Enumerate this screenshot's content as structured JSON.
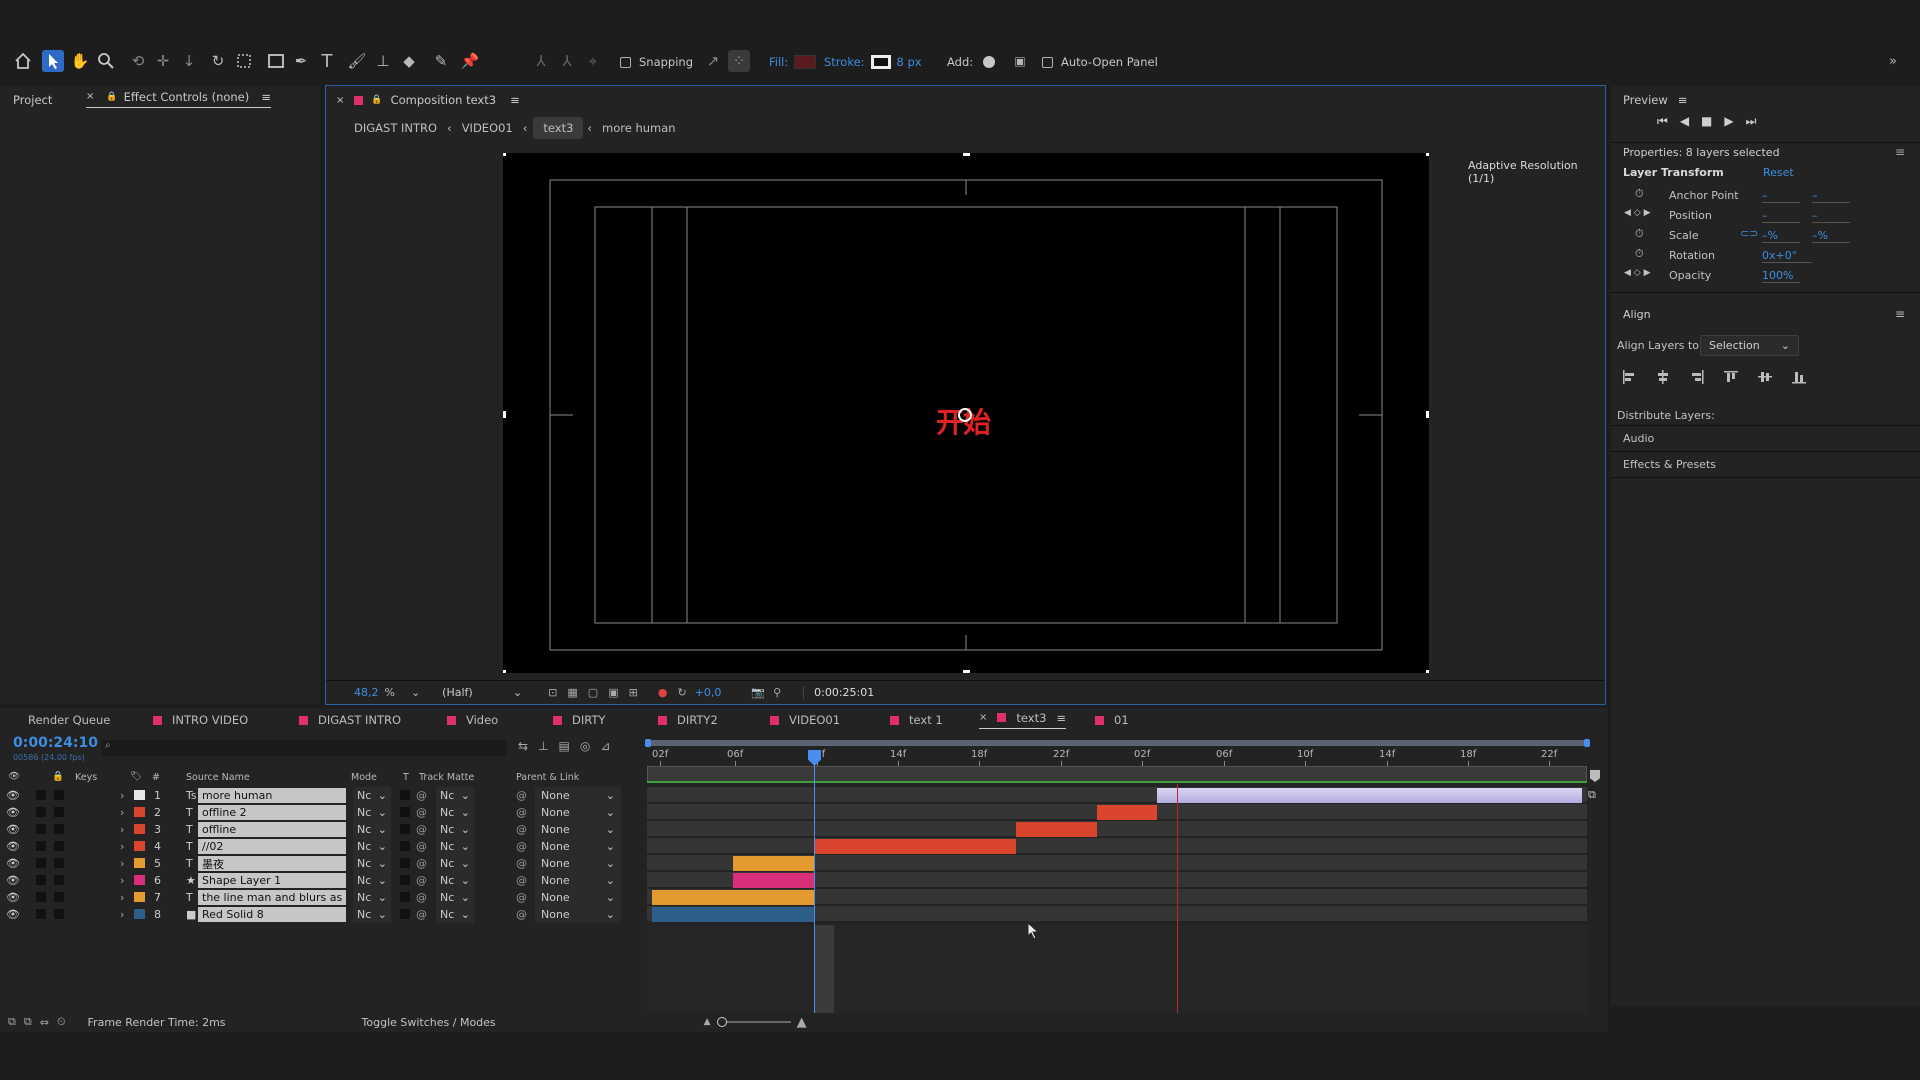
{
  "toolbar": {
    "snapping_label": "Snapping",
    "fill_label": "Fill:",
    "stroke_label": "Stroke:",
    "stroke_width": "8 px",
    "add_label": "Add:",
    "auto_open_label": "Auto-Open Panel",
    "fill_color": "#c0262c"
  },
  "left_panel": {
    "project_tab": "Project",
    "effect_controls_tab": "Effect Controls (none)"
  },
  "composition": {
    "tab_label": "Composition text3",
    "breadcrumbs": [
      "DIGAST INTRO",
      "VIDEO01",
      "text3",
      "more human"
    ],
    "adaptive_label": "Adaptive Resolution (1/1)",
    "canvas_text": "开始",
    "zoom": "48,2",
    "zoom_unit": "%",
    "resolution": "(Half)",
    "exposure": "+0,0",
    "timecode": "0:00:25:01"
  },
  "right_panel": {
    "preview_title": "Preview",
    "properties_title": "Properties: 8 layers selected",
    "layer_transform": "Layer Transform",
    "reset": "Reset",
    "props": [
      {
        "name": "Anchor Point",
        "v1": "–",
        "v2": "–"
      },
      {
        "name": "Position",
        "v1": "–",
        "v2": "–"
      },
      {
        "name": "Scale",
        "v1": "–%",
        "v2": "–%"
      },
      {
        "name": "Rotation",
        "v1": "0x+0°",
        "v2": ""
      },
      {
        "name": "Opacity",
        "v1": "100%",
        "v2": ""
      }
    ],
    "align_title": "Align",
    "align_layers_to": "Align Layers to:",
    "align_selection": "Selection",
    "distribute_label": "Distribute Layers:",
    "audio": "Audio",
    "effects_presets": "Effects & Presets"
  },
  "timeline": {
    "tabs": [
      {
        "label": "Render Queue",
        "color": ""
      },
      {
        "label": "INTRO VIDEO",
        "color": "#e0306a"
      },
      {
        "label": "DIGAST INTRO",
        "color": "#e0306a"
      },
      {
        "label": "Video",
        "color": "#e0306a"
      },
      {
        "label": "DIRTY",
        "color": "#e0306a"
      },
      {
        "label": "DIRTY2",
        "color": "#e0306a"
      },
      {
        "label": "VIDEO01",
        "color": "#e0306a"
      },
      {
        "label": "text 1",
        "color": "#e0306a"
      },
      {
        "label": "text3",
        "color": "#e0306a"
      },
      {
        "label": "01",
        "color": "#e0306a"
      }
    ],
    "current_time": "0:00:24:10",
    "frame_info": "00586 (24.00 fps)",
    "columns": {
      "keys": "Keys",
      "num": "#",
      "source": "Source Name",
      "mode": "Mode",
      "t": "T",
      "track_matte": "Track Matte",
      "parent": "Parent & Link"
    },
    "ruler": [
      "02f",
      "06f",
      "10f",
      "14f",
      "18f",
      "22f",
      "02f",
      "06f",
      "10f",
      "14f",
      "18f",
      "22f"
    ],
    "layers": [
      {
        "num": "1",
        "name": "more human",
        "label_color": "#e8e8e8",
        "type": "Ts",
        "mode": "Nc",
        "matte": "Nc",
        "parent": "None"
      },
      {
        "num": "2",
        "name": "offline 2",
        "label_color": "#d9452d",
        "type": "T",
        "mode": "Nc",
        "matte": "Nc",
        "parent": "None"
      },
      {
        "num": "3",
        "name": "offline",
        "label_color": "#d9452d",
        "type": "T",
        "mode": "Nc",
        "matte": "Nc",
        "parent": "None"
      },
      {
        "num": "4",
        "name": "//02",
        "label_color": "#d9452d",
        "type": "T",
        "mode": "Nc",
        "matte": "Nc",
        "parent": "None"
      },
      {
        "num": "5",
        "name": "墨夜",
        "label_color": "#e39b2f",
        "type": "T",
        "mode": "Nc",
        "matte": "Nc",
        "parent": "None"
      },
      {
        "num": "6",
        "name": "Shape Layer 1",
        "label_color": "#d92f7a",
        "type": "★",
        "mode": "Nc",
        "matte": "Nc",
        "parent": "None"
      },
      {
        "num": "7",
        "name": "the line man and blurs as",
        "label_color": "#e39b2f",
        "type": "T",
        "mode": "Nc",
        "matte": "Nc",
        "parent": "None"
      },
      {
        "num": "8",
        "name": "Red Solid 8",
        "label_color": "#2e5e8a",
        "type": "■",
        "mode": "Nc",
        "matte": "Nc",
        "parent": "None"
      }
    ],
    "footer_render_time": "Frame Render Time:  2ms",
    "footer_toggle": "Toggle Switches / Modes"
  }
}
